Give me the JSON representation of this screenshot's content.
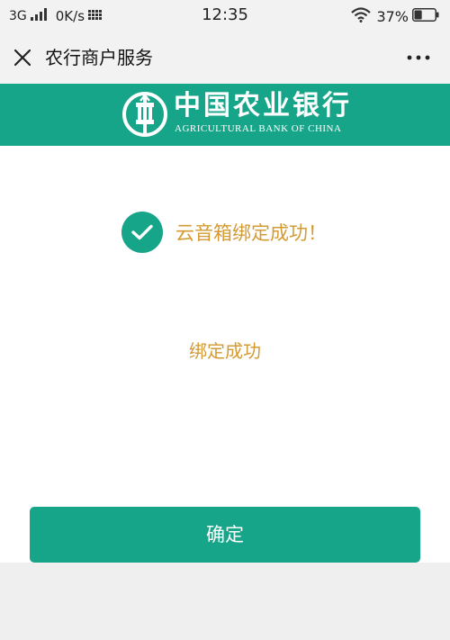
{
  "status_bar": {
    "network": "3G",
    "speed": "0K/s",
    "time": "12:35",
    "battery_pct": "37%",
    "battery_level": 0.37,
    "icons": [
      "signal-icon",
      "data-grid-icon",
      "wifi-icon",
      "battery-icon"
    ]
  },
  "nav": {
    "title": "农行商户服务",
    "close_icon": "close-icon",
    "more_icon": "more-dots-icon"
  },
  "banner": {
    "name_cn": "中国农业银行",
    "name_en": "AGRICULTURAL BANK OF CHINA",
    "logo_icon": "abc-logo-icon"
  },
  "main": {
    "success_text": "云音箱绑定成功！",
    "status_message": "绑定成功",
    "confirm_label": "确定",
    "check_icon": "check-circle-icon"
  },
  "colors": {
    "brand": "#17a58a",
    "accent_text": "#d49a33",
    "bar_bg": "#f2f2f2"
  }
}
